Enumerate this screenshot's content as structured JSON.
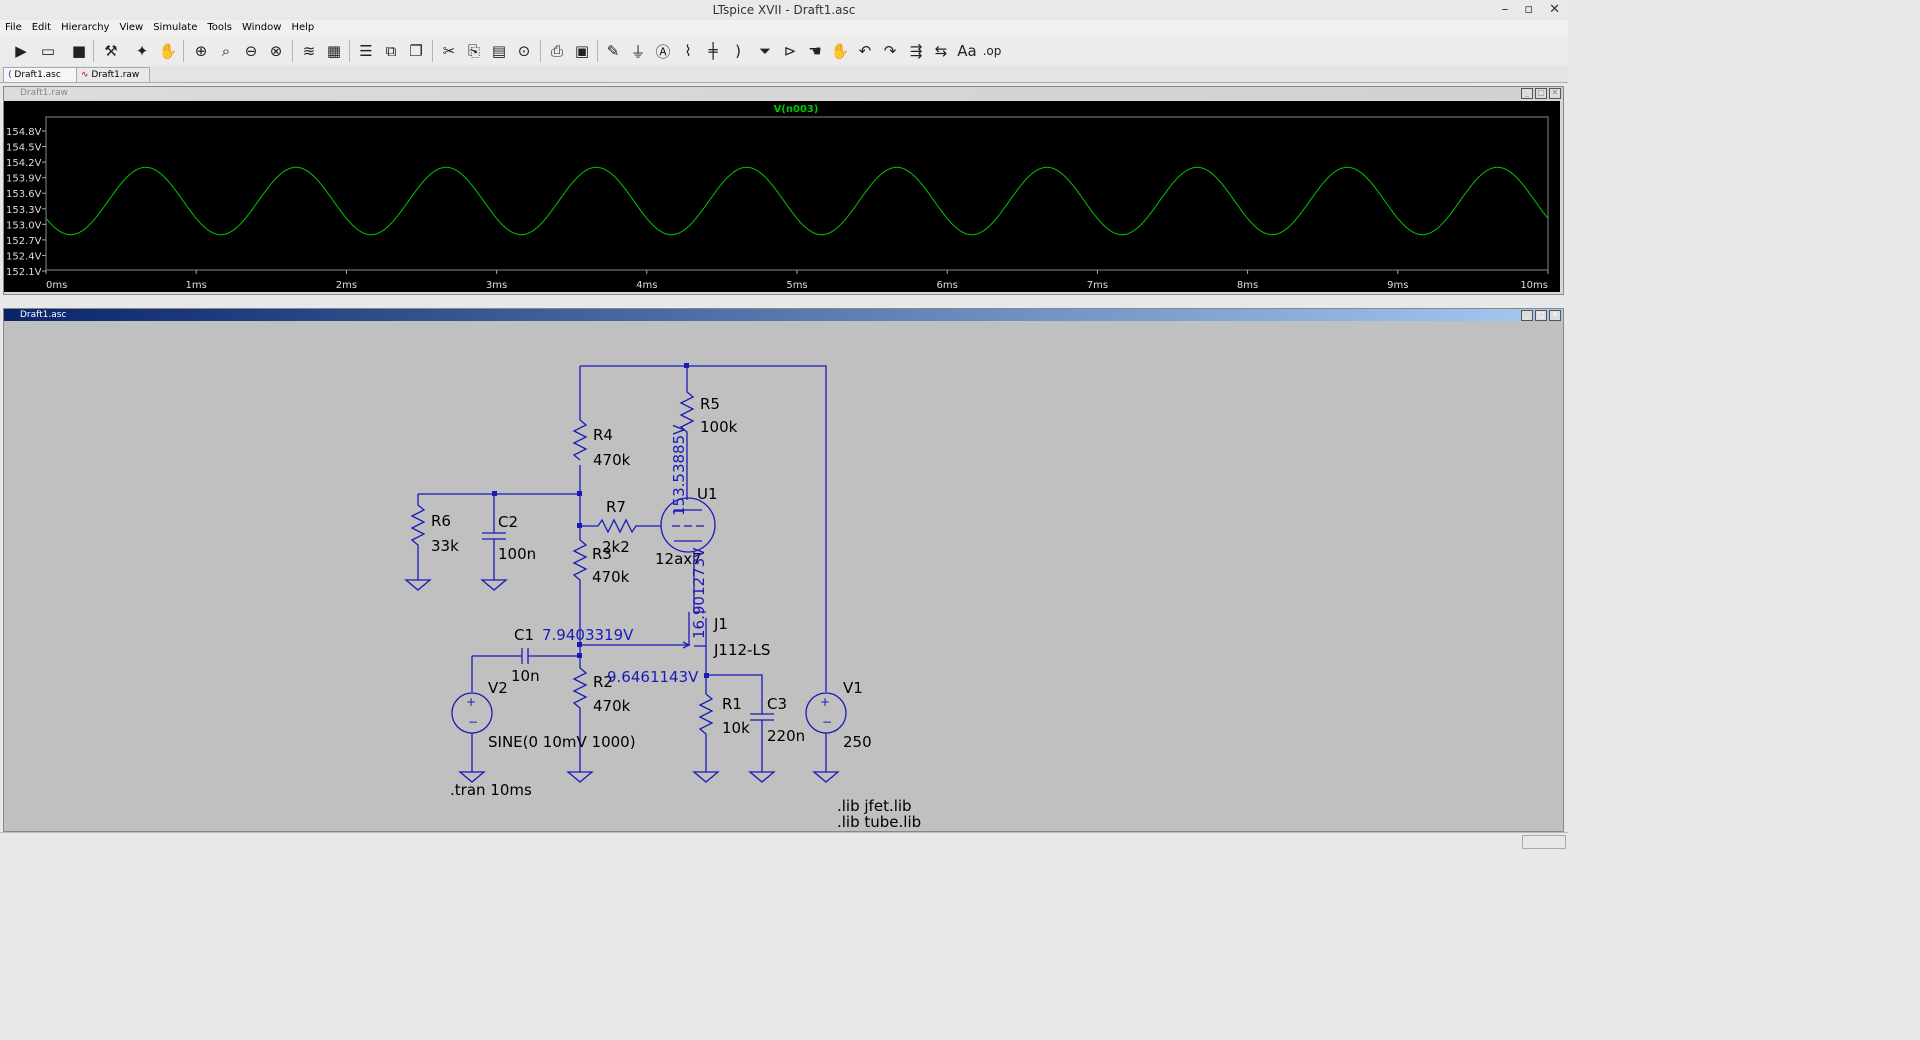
{
  "window": {
    "title": "LTspice XVII - Draft1.asc"
  },
  "menu": [
    "File",
    "Edit",
    "Hierarchy",
    "View",
    "Simulate",
    "Tools",
    "Window",
    "Help"
  ],
  "tabs": [
    {
      "label": "Draft1.asc"
    },
    {
      "label": "Draft1.raw"
    }
  ],
  "plot_window": {
    "title": "Draft1.raw"
  },
  "schematic_window": {
    "title": "Draft1.asc"
  },
  "chart_data": {
    "type": "line",
    "title": "V(n003)",
    "xlabel": "",
    "ylabel": "",
    "x_ticks": [
      "0ms",
      "1ms",
      "2ms",
      "3ms",
      "4ms",
      "5ms",
      "6ms",
      "7ms",
      "8ms",
      "9ms",
      "10ms"
    ],
    "y_ticks": [
      "154.8V",
      "154.5V",
      "154.2V",
      "153.9V",
      "153.6V",
      "153.3V",
      "153.0V",
      "152.7V",
      "152.4V",
      "152.1V"
    ],
    "xlim": [
      0,
      10
    ],
    "ylim": [
      152.1,
      154.8
    ],
    "series": [
      {
        "name": "V(n003)",
        "frequency_hz": 1000,
        "offset_v": 153.45,
        "amplitude_v": 0.65,
        "color": "#00c800"
      }
    ]
  },
  "schematic": {
    "labels": {
      "r4": "R4",
      "r4v": "470k",
      "r5": "R5",
      "r5v": "100k",
      "r6": "R6",
      "r6v": "33k",
      "c2": "C2",
      "c2v": "100n",
      "r7": "R7",
      "r7v": "2k2",
      "r3": "R3",
      "r3v": "470k",
      "u1": "U1",
      "u1v": "12ax7",
      "c1": "C1",
      "c1v": "10n",
      "j1": "J1",
      "j1v": "J112-LS",
      "r2": "R2",
      "r2v": "470k",
      "r1": "R1",
      "r1v": "10k",
      "c3": "C3",
      "c3v": "220n",
      "v1": "V1",
      "v1v": "250",
      "v2": "V2",
      "v2v": "SINE(0 10mV 1000)",
      "tran": ".tran 10ms",
      "lib1": ".lib jfet.lib",
      "lib2": ".lib tube.lib"
    },
    "voltages": {
      "plate": "153.53885V",
      "cathode": "16.901273V",
      "gate": "7.9403319V",
      "source": "9.6461143V"
    }
  }
}
